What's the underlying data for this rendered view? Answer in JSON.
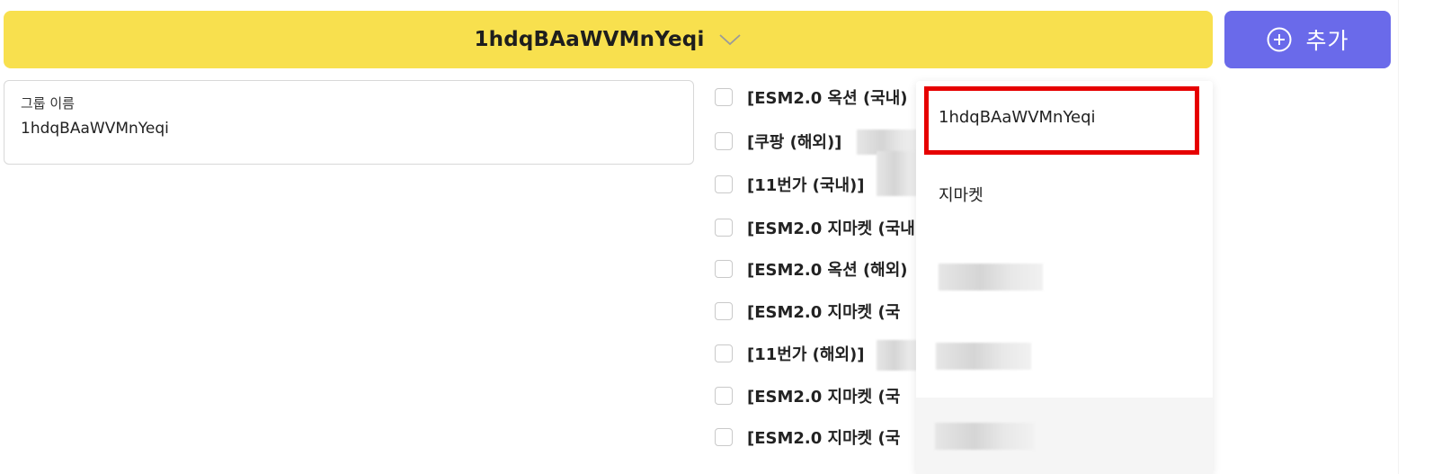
{
  "group_selector": {
    "selected": "1hdqBAaWVMnYeqi",
    "chevron_icon": "chevron-down-icon"
  },
  "add_button": {
    "label": "추가",
    "icon": "plus-circle-icon",
    "color": "#6a6aea"
  },
  "group_name_field": {
    "label": "그룹 이름",
    "value": "1hdqBAaWVMnYeqi"
  },
  "markets": [
    {
      "label": "[ESM2.0 옥션 (국내)",
      "checked": false
    },
    {
      "label": "[쿠팡 (해외)]",
      "checked": false
    },
    {
      "label": "[11번가 (국내)]",
      "checked": false
    },
    {
      "label": "[ESM2.0 지마켓 (국내",
      "checked": false
    },
    {
      "label": "[ESM2.0 옥션 (해외)",
      "checked": false
    },
    {
      "label": "[ESM2.0 지마켓 (국",
      "checked": false
    },
    {
      "label": "[11번가 (해외)]",
      "checked": false
    },
    {
      "label": "[ESM2.0 지마켓 (국",
      "checked": false
    },
    {
      "label": "[ESM2.0 지마켓 (국",
      "checked": false
    }
  ],
  "dropdown": {
    "options": [
      {
        "label": "1hdqBAaWVMnYeqi",
        "highlighted": true
      },
      {
        "label": "지마켓"
      },
      {
        "label": "",
        "redacted": true
      },
      {
        "label": "",
        "redacted": true
      },
      {
        "label": "",
        "redacted": true
      }
    ]
  },
  "colors": {
    "selector_bg": "#f8e04e",
    "highlight_border": "#e60000"
  }
}
